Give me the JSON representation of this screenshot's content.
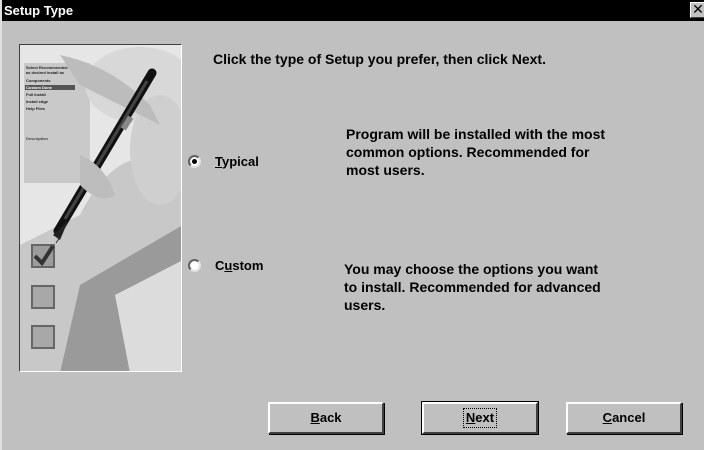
{
  "window": {
    "title": "Setup Type",
    "close_glyph": "✕"
  },
  "instruction": "Click the type of Setup you prefer, then click Next.",
  "options": [
    {
      "key_letter": "T",
      "rest": "ypical",
      "selected": true,
      "description_lines": [
        "Program will be installed with the most",
        "common options. Recommended for",
        "most users."
      ]
    },
    {
      "prefix": "C",
      "key_letter": "u",
      "rest": "stom",
      "selected": false,
      "description_lines": [
        "You may choose the options you want",
        "to install. Recommended for advanced",
        "users."
      ]
    }
  ],
  "buttons": {
    "back": {
      "key_letter": "B",
      "rest": "ack"
    },
    "next": {
      "key_letter": "N",
      "rest": "ext"
    },
    "cancel": {
      "key_letter": "C",
      "rest": "ancel"
    }
  },
  "art": {
    "list_lines": [
      "Select Recommended",
      "as desired install as",
      "Components",
      "Custom Done",
      "Full Install",
      "Install edge",
      "Help Files",
      "Description"
    ]
  }
}
